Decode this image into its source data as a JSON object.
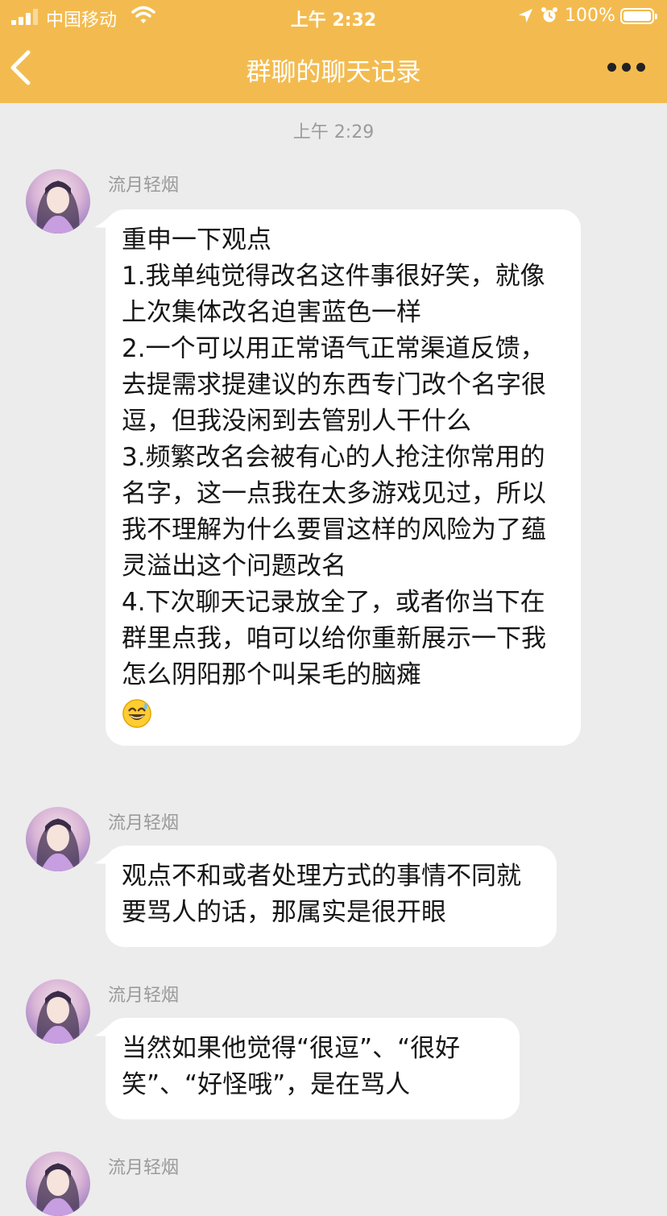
{
  "status_bar": {
    "carrier": "中国移动",
    "time": "上午 2:32",
    "battery": "100%",
    "battery_level": 1.0
  },
  "nav": {
    "title": "群聊的聊天记录",
    "back_icon": "chevron-left-icon",
    "more_icon": "more-dots-icon"
  },
  "timestamp": "上午 2:29",
  "messages": [
    {
      "sender": "流月轻烟",
      "text": "重申一下观点\n1.我单纯觉得改名这件事很好笑，就像上次集体改名迫害蓝色一样\n2.一个可以用正常语气正常渠道反馈，去提需求提建议的东西专门改个名字很逗，但我没闲到去管别人干什么\n3.频繁改名会被有心的人抢注你常用的名字，这一点我在太多游戏见过，所以我不理解为什么要冒这样的风险为了蕴灵溢出这个问题改名\n4.下次聊天记录放全了，或者你当下在群里点我，咱可以给你重新展示一下我怎么阴阳那个叫呆毛的脑瘫",
      "emoji": "😅"
    },
    {
      "sender": "流月轻烟",
      "text": "观点不和或者处理方式的事情不同就要骂人的话，那属实是很开眼"
    },
    {
      "sender": "流月轻烟",
      "text": "当然如果他觉得“很逗”、“很好笑”、“好怪哦”，是在骂人"
    },
    {
      "sender": "流月轻烟"
    }
  ],
  "colors": {
    "header": "#f3bb4f",
    "background": "#ececec",
    "bubble": "#ffffff",
    "sender": "#9a9a9a"
  }
}
